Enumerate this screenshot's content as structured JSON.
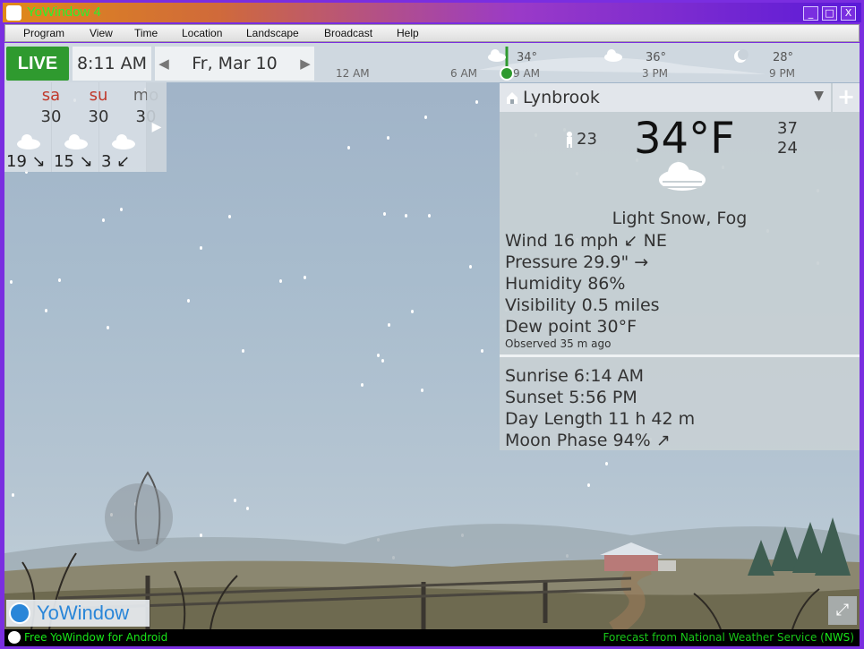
{
  "window": {
    "title": "YoWindow 4",
    "minimize": "_",
    "maximize": "□",
    "close": "X"
  },
  "menu": [
    "Program",
    "View",
    "Time",
    "Location",
    "Landscape",
    "Broadcast",
    "Help"
  ],
  "topbar": {
    "live_label": "LIVE",
    "time": "8:11 AM",
    "date": "Fr, Mar 10",
    "prev_arrow": "◀",
    "next_arrow": "▶"
  },
  "timeline": {
    "ticks": [
      "12 AM",
      "6 AM",
      "9 AM",
      "3 PM",
      "9 PM"
    ],
    "temps": [
      "34°",
      "36°",
      "28°"
    ],
    "temp_icons": [
      "cloud-icon",
      "cloud-icon",
      "moon-icon"
    ]
  },
  "forecast": {
    "days": [
      {
        "name": "sa",
        "high": "30",
        "low": "19 ↘",
        "color": "#c0392b"
      },
      {
        "name": "su",
        "high": "30",
        "low": "15 ↘",
        "color": "#c0392b"
      },
      {
        "name": "mo",
        "high": "30",
        "low": "3 ↙",
        "color": "#666666"
      }
    ],
    "next": "▶"
  },
  "current": {
    "location": "Lynbrook",
    "dropdown": "▼",
    "add": "+",
    "feels_like": "23",
    "temperature": "34°F",
    "high": "37",
    "low": "24",
    "condition": "Light Snow, Fog",
    "wind": "Wind  16 mph ↙ NE",
    "pressure": "Pressure  29.9\" →",
    "humidity": "Humidity  86%",
    "visibility": "Visibility  0.5 miles",
    "dew_point": "Dew point  30°F",
    "observed": "Observed 35 m ago",
    "sunrise": "Sunrise  6:14 AM",
    "sunset": "Sunset  5:56 PM",
    "day_length": "Day Length  11 h 42 m",
    "moon_phase": "Moon Phase  94% ↗"
  },
  "brand": {
    "name": "YoWindow"
  },
  "status": {
    "left": "Free YoWindow for Android",
    "right": "Forecast from National Weather Service (",
    "right_link": "NWS",
    "right_end": ")"
  },
  "colors": {
    "live": "#2f9a2f",
    "status_text": "#18e818",
    "brand": "#2a86d8"
  }
}
